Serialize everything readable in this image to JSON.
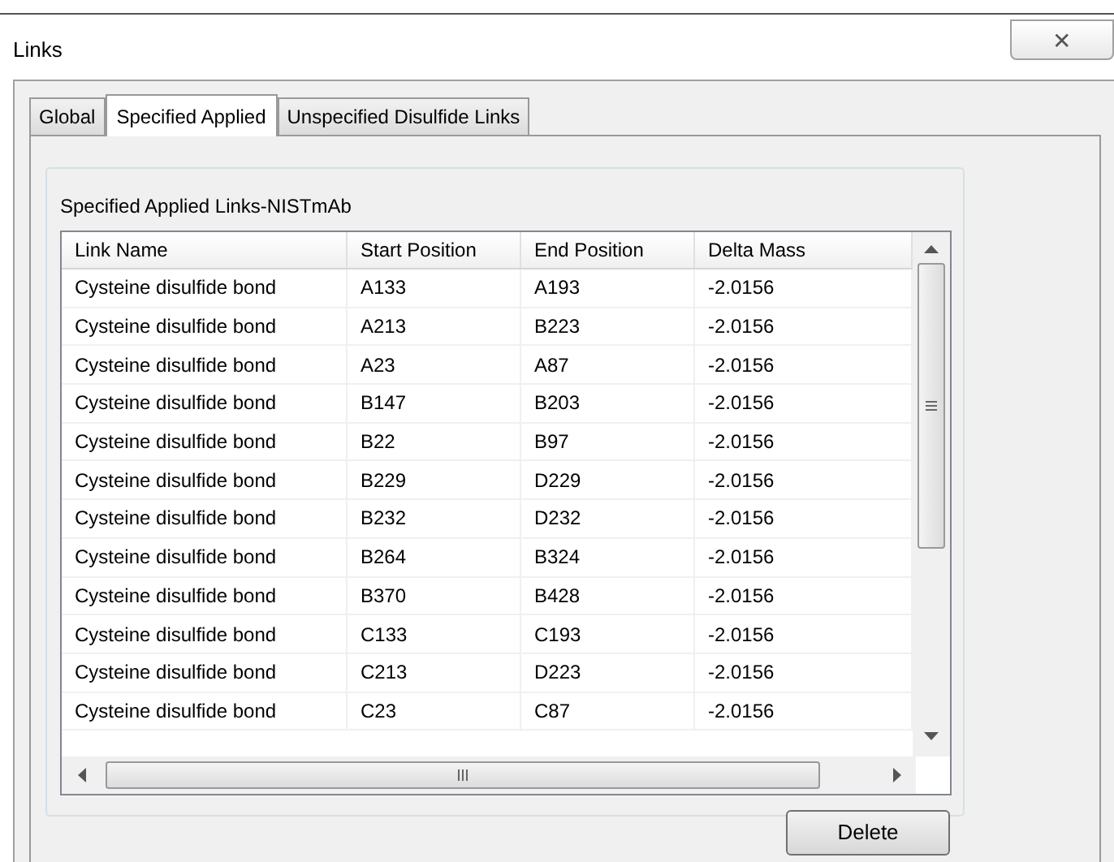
{
  "window": {
    "title": "Links",
    "close": "✕"
  },
  "tabs": [
    {
      "label": "Global",
      "selected": false
    },
    {
      "label": "Specified Applied",
      "selected": true
    },
    {
      "label": "Unspecified Disulfide Links",
      "selected": false
    }
  ],
  "group": {
    "title": "Specified Applied Links-NISTmAb"
  },
  "table": {
    "columns": [
      "Link Name",
      "Start Position",
      "End Position",
      "Delta Mass"
    ],
    "rows": [
      [
        "Cysteine disulfide bond",
        "A133",
        "A193",
        "-2.0156"
      ],
      [
        "Cysteine disulfide bond",
        "A213",
        "B223",
        "-2.0156"
      ],
      [
        "Cysteine disulfide bond",
        "A23",
        "A87",
        "-2.0156"
      ],
      [
        "Cysteine disulfide bond",
        "B147",
        "B203",
        "-2.0156"
      ],
      [
        "Cysteine disulfide bond",
        "B22",
        "B97",
        "-2.0156"
      ],
      [
        "Cysteine disulfide bond",
        "B229",
        "D229",
        "-2.0156"
      ],
      [
        "Cysteine disulfide bond",
        "B232",
        "D232",
        "-2.0156"
      ],
      [
        "Cysteine disulfide bond",
        "B264",
        "B324",
        "-2.0156"
      ],
      [
        "Cysteine disulfide bond",
        "B370",
        "B428",
        "-2.0156"
      ],
      [
        "Cysteine disulfide bond",
        "C133",
        "C193",
        "-2.0156"
      ],
      [
        "Cysteine disulfide bond",
        "C213",
        "D223",
        "-2.0156"
      ],
      [
        "Cysteine disulfide bond",
        "C23",
        "C87",
        "-2.0156"
      ]
    ]
  },
  "buttons": [
    "Delete"
  ]
}
